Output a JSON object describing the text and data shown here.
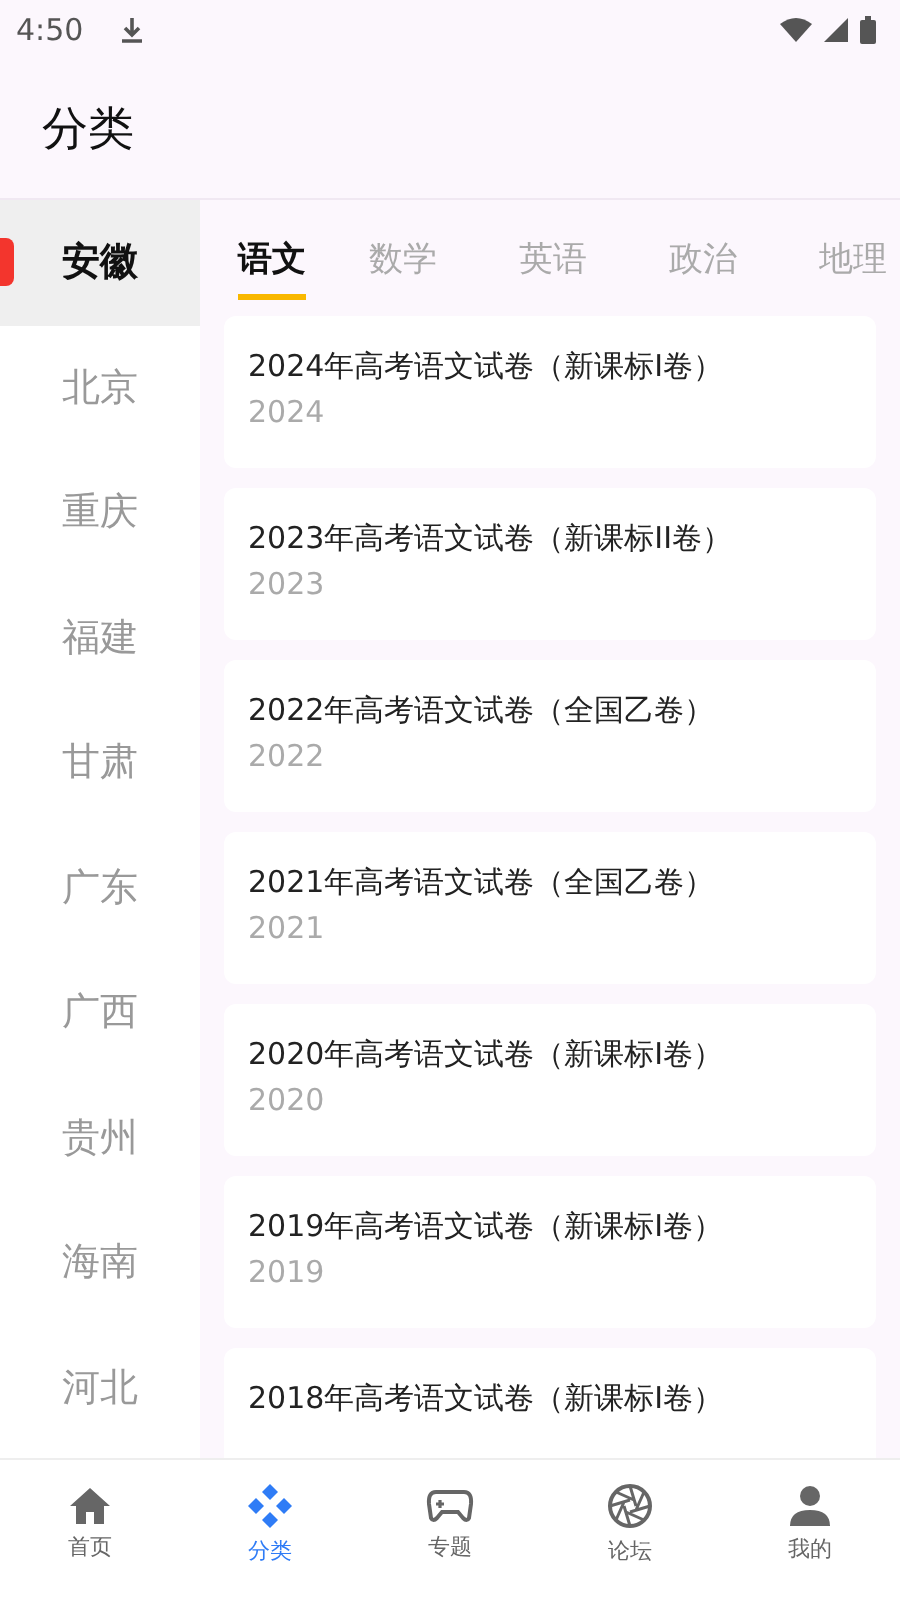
{
  "status_bar": {
    "time": "4:50"
  },
  "header": {
    "title": "分类"
  },
  "provinces": [
    {
      "label": "安徽",
      "selected": true
    },
    {
      "label": "北京",
      "selected": false
    },
    {
      "label": "重庆",
      "selected": false
    },
    {
      "label": "福建",
      "selected": false
    },
    {
      "label": "甘肃",
      "selected": false
    },
    {
      "label": "广东",
      "selected": false
    },
    {
      "label": "广西",
      "selected": false
    },
    {
      "label": "贵州",
      "selected": false
    },
    {
      "label": "海南",
      "selected": false
    },
    {
      "label": "河北",
      "selected": false
    }
  ],
  "subjects": [
    {
      "label": "语文",
      "selected": true
    },
    {
      "label": "数学",
      "selected": false
    },
    {
      "label": "英语",
      "selected": false
    },
    {
      "label": "政治",
      "selected": false
    },
    {
      "label": "地理",
      "selected": false
    }
  ],
  "papers": [
    {
      "title": "2024年高考语文试卷（新课标I卷）",
      "year": "2024"
    },
    {
      "title": "2023年高考语文试卷（新课标II卷）",
      "year": "2023"
    },
    {
      "title": "2022年高考语文试卷（全国乙卷）",
      "year": "2022"
    },
    {
      "title": "2021年高考语文试卷（全国乙卷）",
      "year": "2021"
    },
    {
      "title": "2020年高考语文试卷（新课标I卷）",
      "year": "2020"
    },
    {
      "title": "2019年高考语文试卷（新课标I卷）",
      "year": "2019"
    },
    {
      "title": "2018年高考语文试卷（新课标I卷）"
    }
  ],
  "bottom_nav": [
    {
      "kind": "home",
      "label": "首页",
      "selected": false
    },
    {
      "kind": "category",
      "label": "分类",
      "selected": true
    },
    {
      "kind": "topic",
      "label": "专题",
      "selected": false
    },
    {
      "kind": "forum",
      "label": "论坛",
      "selected": false
    },
    {
      "kind": "me",
      "label": "我的",
      "selected": false
    }
  ]
}
